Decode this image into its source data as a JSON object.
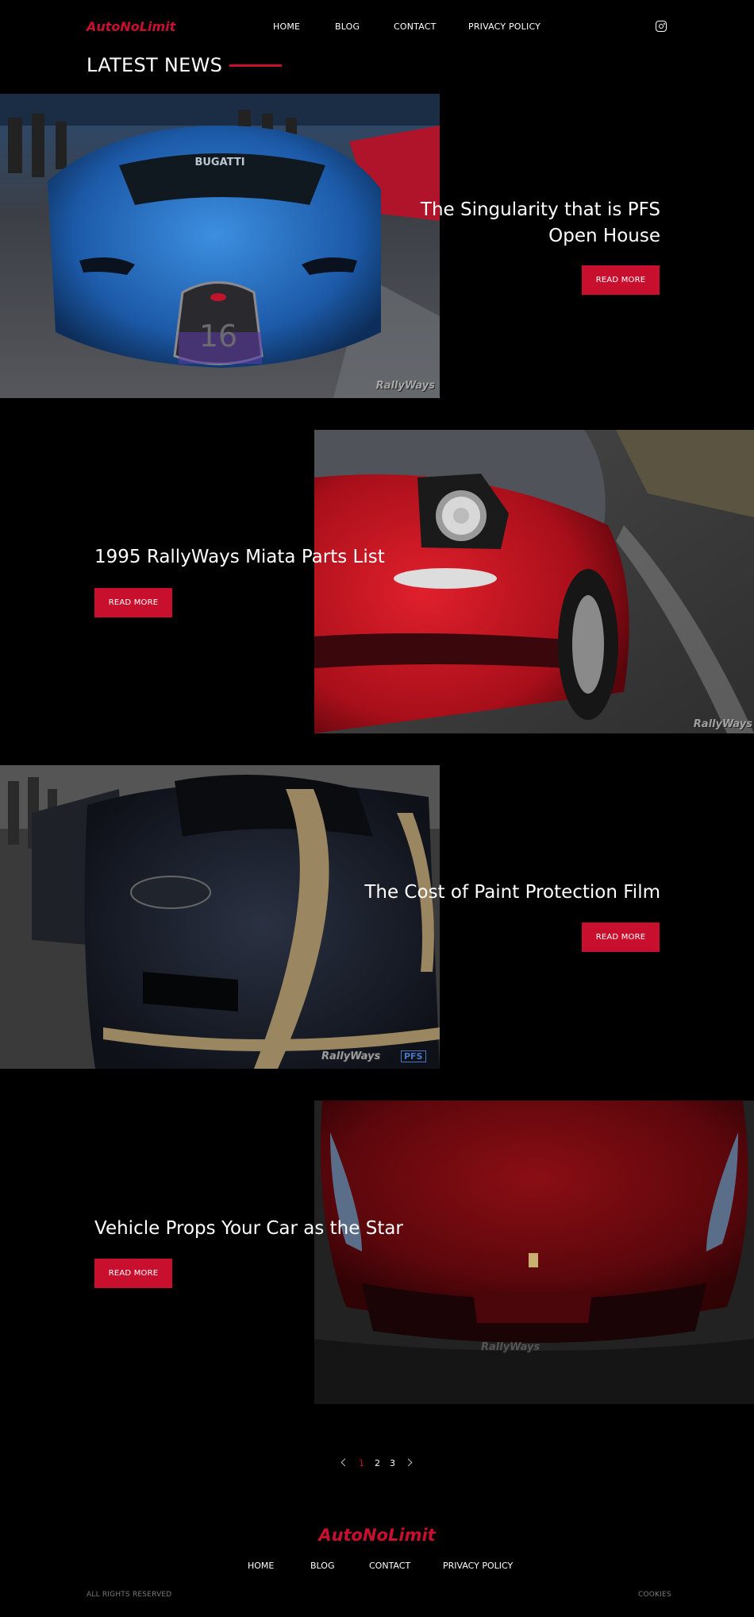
{
  "header": {
    "logo": "AutoNoLimit",
    "nav": [
      "HOME",
      "BLOG",
      "CONTACT",
      "PRIVACY POLICY"
    ],
    "social_icon": "instagram-icon"
  },
  "section_title": "LATEST NEWS",
  "articles": [
    {
      "title": "The Singularity that is PFS Open House",
      "button": "READ MORE",
      "image_text": "BUGATTI",
      "plate": "16",
      "watermark": "RallyWays"
    },
    {
      "title": "1995 RallyWays Miata Parts List",
      "button": "READ MORE",
      "watermark": "RallyWays"
    },
    {
      "title": "The Cost of Paint Protection Film",
      "button": "READ MORE",
      "watermark": "RallyWays",
      "badge": "PFS"
    },
    {
      "title": "Vehicle Props Your Car as the Star",
      "button": "READ MORE",
      "watermark": "RallyWays"
    }
  ],
  "pagination": {
    "pages": [
      "1",
      "2",
      "3"
    ],
    "current": "1"
  },
  "footer": {
    "logo": "AutoNoLimit",
    "nav": [
      "HOME",
      "BLOG",
      "CONTACT",
      "PRIVACY POLICY"
    ],
    "rights": "ALL RIGHTS RESERVED",
    "cookies": "COOKIES"
  },
  "colors": {
    "accent": "#c8102e",
    "background": "#000000"
  }
}
